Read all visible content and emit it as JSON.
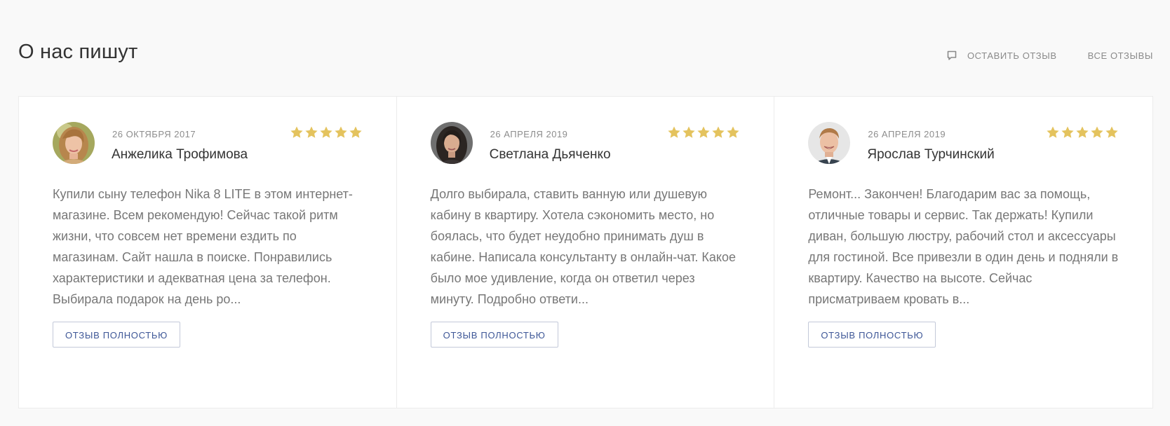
{
  "section": {
    "title": "О нас пишут",
    "actions": {
      "leave_review": "ОСТАВИТЬ ОТЗЫВ",
      "all_reviews": "ВСЕ ОТЗЫВЫ"
    }
  },
  "reviews": [
    {
      "date": "26 ОКТЯБРЯ 2017",
      "name": "Анжелика Трофимова",
      "rating": 5,
      "text": "Купили сыну телефон Nika 8 LITE в этом интернет-магазине. Всем рекомендую! Сейчас такой ритм жизни, что совсем нет времени ездить по магазинам. Сайт нашла в поиске. Понравились характеристики и адекватная цена за телефон. Выбирала подарок на день ро...",
      "button": "ОТЗЫВ ПОЛНОСТЬЮ"
    },
    {
      "date": "26 АПРЕЛЯ 2019",
      "name": "Светлана Дьяченко",
      "rating": 5,
      "text": "Долго выбирала, ставить ванную или душевую кабину в квартиру. Хотела сэкономить место, но боялась, что будет неудобно принимать душ в кабине. Написала консультанту в онлайн-чат. Какое было мое удивление, когда он ответил через минуту. Подробно ответи...",
      "button": "ОТЗЫВ ПОЛНОСТЬЮ"
    },
    {
      "date": "26 АПРЕЛЯ 2019",
      "name": "Ярослав Турчинский",
      "rating": 5,
      "text": "Ремонт... Закончен! Благодарим вас за помощь, отличные товары и сервис. Так держать! Купили диван, большую люстру, рабочий стол и аксессуары для гостиной. Все привезли в один день и подняли в квартиру. Качество на высоте. Сейчас присматриваем кровать в...",
      "button": "ОТЗЫВ ПОЛНОСТЬЮ"
    }
  ],
  "icons": {
    "leave_review": "chat-bubble-icon",
    "rating": "star-icon"
  },
  "colors": {
    "star": "#e4c35e",
    "button_text": "#3e5797",
    "button_border": "#c3c9d9",
    "muted_text": "#8a8a8a"
  }
}
